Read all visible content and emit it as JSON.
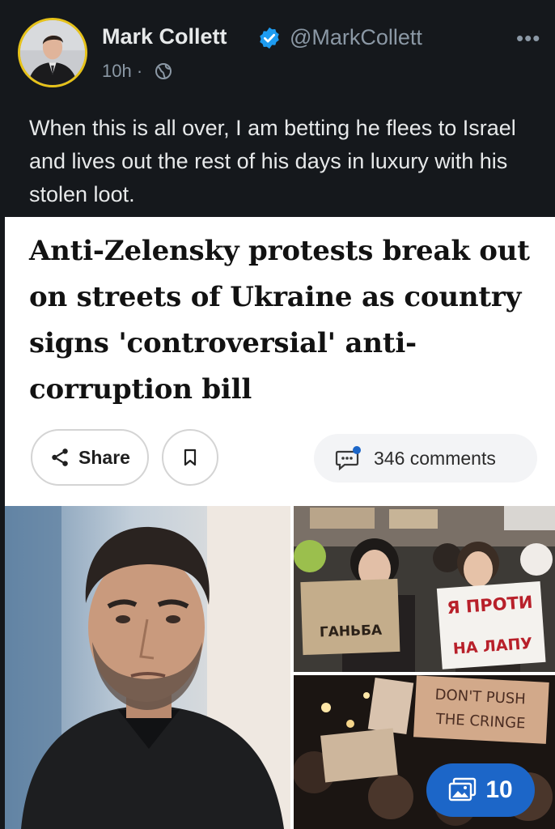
{
  "post": {
    "author_name": "Mark Collett",
    "handle": "@MarkCollett",
    "timestamp": "10h ·",
    "more_icon": "more-horizontal-icon",
    "visibility_icon": "globe-icon",
    "verified_icon": "verified-badge-icon",
    "text": "When this is all over, I am betting he flees to Israel and lives out the rest of his days in luxury with his stolen loot."
  },
  "article": {
    "headline": "Anti-Zelensky protests break out on streets of Ukraine as country signs 'controversial' anti-corruption bill",
    "share_label": "Share",
    "comments_label": "346 comments",
    "share_icon": "share-icon",
    "bookmark_icon": "bookmark-icon",
    "comments_icon": "comment-bubble-icon",
    "photo_count": "10",
    "photo_count_icon": "gallery-icon"
  },
  "photos": {
    "sign_1_line1": "Я ПРОТИ",
    "sign_1_line2": "НА ЛАПУ",
    "sign_2": "ГАНЬБА",
    "sign_3_line1": "DON'T PUSH",
    "sign_3_line2": "THE CRINGE"
  },
  "colors": {
    "dark_background": "#15181c",
    "verified_blue": "#1d9bf0",
    "badge_blue": "#1c66c8",
    "avatar_ring": "#e6c21a"
  }
}
